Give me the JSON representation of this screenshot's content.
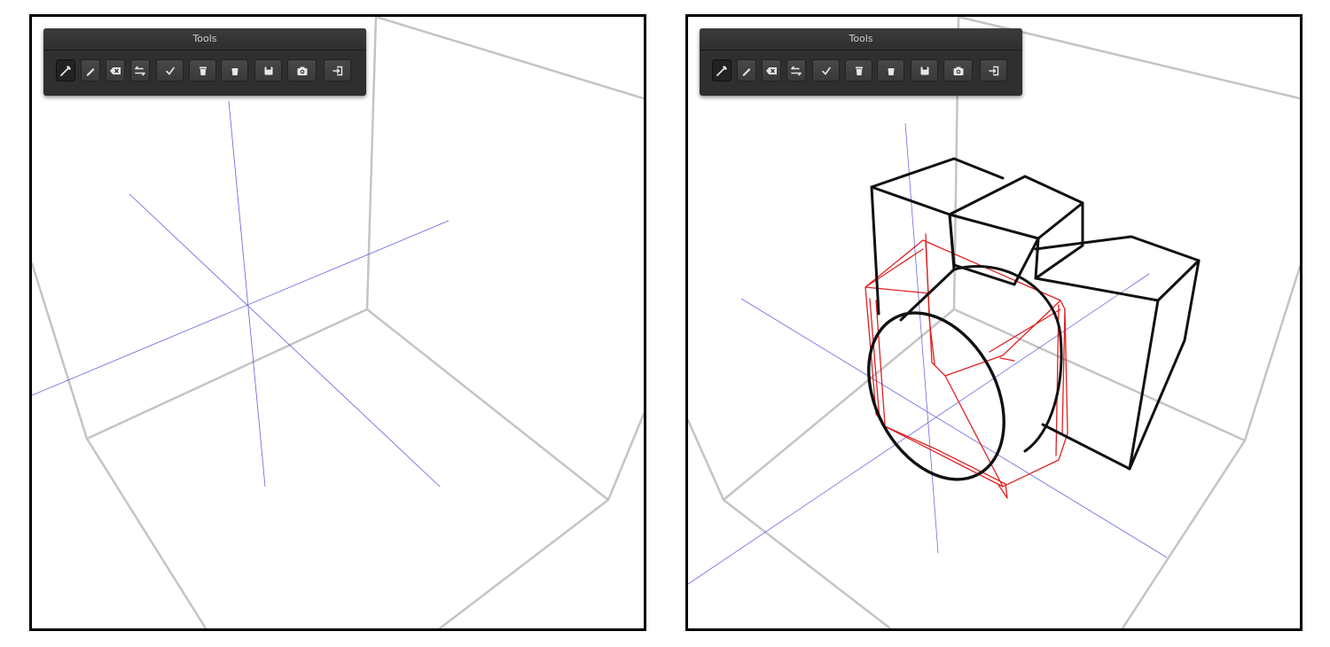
{
  "left_view": {
    "toolbar": {
      "title": "Tools",
      "buttons": [
        {
          "icon": "brush-icon",
          "active": true
        },
        {
          "icon": "pencil-icon",
          "active": false
        },
        {
          "icon": "eraser-icon",
          "active": false
        },
        {
          "icon": "swap-icon",
          "active": false
        },
        {
          "icon": "check-icon",
          "active": false
        },
        {
          "icon": "trash-icon",
          "active": false
        },
        {
          "icon": "trash-all-icon",
          "active": false
        },
        {
          "icon": "save-icon",
          "active": false
        },
        {
          "icon": "camera-icon",
          "active": false
        },
        {
          "icon": "exit-icon",
          "active": false
        }
      ]
    }
  },
  "right_view": {
    "toolbar": {
      "title": "Tools",
      "buttons": [
        {
          "icon": "brush-icon",
          "active": true
        },
        {
          "icon": "pencil-icon",
          "active": false
        },
        {
          "icon": "eraser-icon",
          "active": false
        },
        {
          "icon": "swap-icon",
          "active": false
        },
        {
          "icon": "check-icon",
          "active": false
        },
        {
          "icon": "trash-icon",
          "active": false
        },
        {
          "icon": "trash-all-icon",
          "active": false
        },
        {
          "icon": "save-icon",
          "active": false
        },
        {
          "icon": "camera-icon",
          "active": false
        },
        {
          "icon": "exit-icon",
          "active": false
        }
      ]
    }
  },
  "colors": {
    "toolbar_bg": "#2f2f2f",
    "button_bg": "#404040",
    "icon": "#e6e6e6",
    "room_edge": "#c4c4c4",
    "axis": "#3a3ad8",
    "stroke_black": "#111111",
    "stroke_red": "#e02020"
  }
}
